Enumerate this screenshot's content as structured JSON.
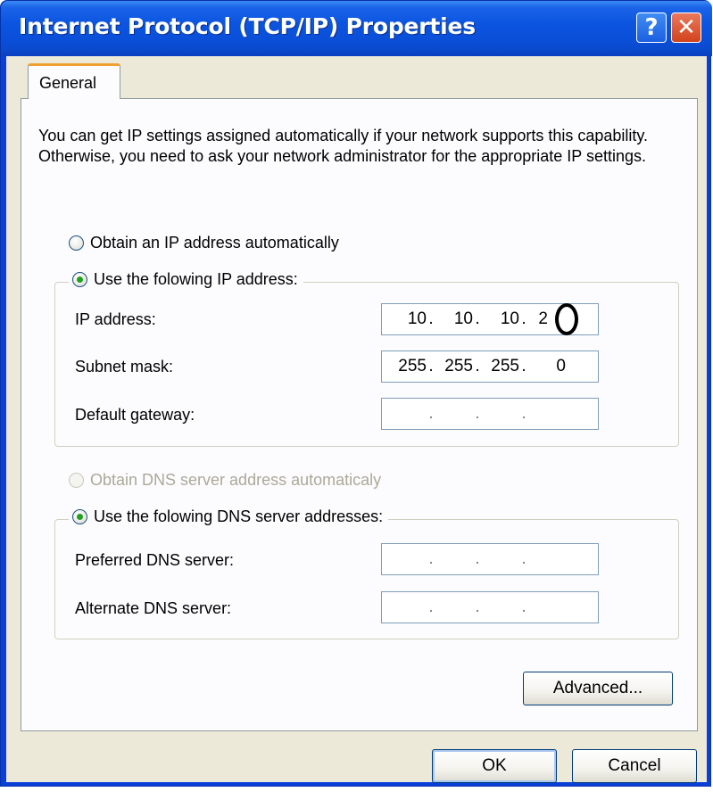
{
  "window": {
    "title": "Internet Protocol (TCP/IP) Properties",
    "help_label": "?",
    "close_label": "✕"
  },
  "tabs": [
    {
      "label": "General",
      "selected": true
    }
  ],
  "intro_text": "You can get IP settings assigned automatically if your network supports this capability. Otherwise, you need to ask your network administrator for the appropriate IP settings.",
  "ip_settings": {
    "auto_label": "Obtain an IP address automatically",
    "auto_selected": false,
    "manual_label": "Use the folowing IP address:",
    "manual_selected": true,
    "ip_address": {
      "label": "IP address:",
      "octets": [
        "10",
        "10",
        "10",
        "2"
      ]
    },
    "subnet_mask": {
      "label": "Subnet mask:",
      "octets": [
        "255",
        "255",
        "255",
        "0"
      ]
    },
    "default_gateway": {
      "label": "Default gateway:",
      "octets": [
        "",
        "",
        "",
        ""
      ]
    }
  },
  "dns_settings": {
    "auto_label": "Obtain DNS server address automaticaly",
    "auto_enabled": false,
    "manual_label": "Use the folowing DNS server addresses:",
    "manual_selected": true,
    "preferred": {
      "label": "Preferred DNS server:",
      "octets": [
        "",
        "",
        "",
        ""
      ]
    },
    "alternate": {
      "label": "Alternate DNS server:",
      "octets": [
        "",
        "",
        "",
        ""
      ]
    }
  },
  "buttons": {
    "advanced": "Advanced...",
    "ok": "OK",
    "cancel": "Cancel"
  },
  "colors": {
    "titlebar": "#0a4fd8",
    "client_bg": "#ece9d8",
    "tab_accent": "#f0a030",
    "close_button": "#d2431c"
  }
}
